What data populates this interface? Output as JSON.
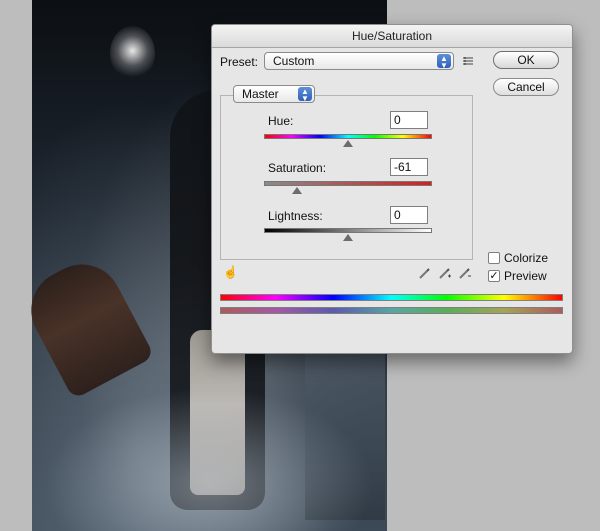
{
  "dialog": {
    "title": "Hue/Saturation",
    "preset": {
      "label": "Preset:",
      "value": "Custom"
    },
    "preset_menu_icon": "preset-options-icon",
    "buttons": {
      "ok": "OK",
      "cancel": "Cancel"
    },
    "channel": {
      "value": "Master"
    },
    "controls": {
      "hue": {
        "label": "Hue:",
        "value": "0",
        "slider_level": 0.5
      },
      "saturation": {
        "label": "Saturation:",
        "value": "-61",
        "slider_level": 0.195
      },
      "lightness": {
        "label": "Lightness:",
        "value": "0",
        "slider_level": 0.5
      }
    },
    "checkboxes": {
      "colorize": {
        "label": "Colorize",
        "checked": false
      },
      "preview": {
        "label": "Preview",
        "checked": true
      }
    },
    "icons": {
      "on_image_adjustment": "targeted-adjustment-hand-icon",
      "eyedropper": "eyedropper-icon",
      "eyedropper_add": "eyedropper-add-icon",
      "eyedropper_subtract": "eyedropper-subtract-icon"
    }
  },
  "colors": {
    "dialog_background": "#e6e6e6",
    "title_bar": "#dadada",
    "field_border": "#7f7f7f",
    "hue_gradient": "rainbow",
    "saturation_gradient": "gray-to-red",
    "lightness_gradient": "black-to-white"
  }
}
